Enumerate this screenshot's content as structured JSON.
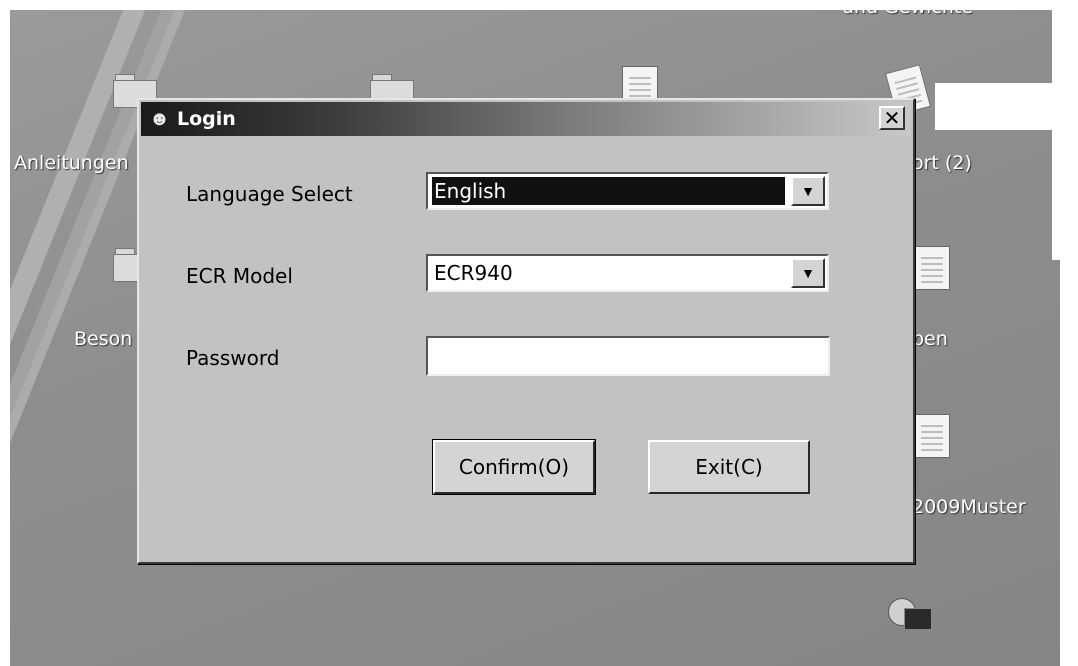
{
  "desktop": {
    "icons": [
      {
        "label": "Anleitungen",
        "type": "folder"
      },
      {
        "label": "Beson",
        "type": "folder"
      },
      {
        "label": "und Gewichte",
        "type": "folder"
      },
      {
        "label": "ort (2)",
        "type": "shortcut"
      },
      {
        "label": "ben",
        "type": "document"
      },
      {
        "label": "2009Muster",
        "type": "document"
      }
    ]
  },
  "dialog": {
    "title": "Login",
    "icon": "user-lock-icon",
    "close_label": "✕",
    "language_label": "Language Select",
    "language_value": "English",
    "model_label": "ECR Model",
    "model_value": "ECR940",
    "password_label": "Password",
    "password_value": "",
    "confirm_label": "Confirm(O)",
    "exit_label": "Exit(C)"
  }
}
